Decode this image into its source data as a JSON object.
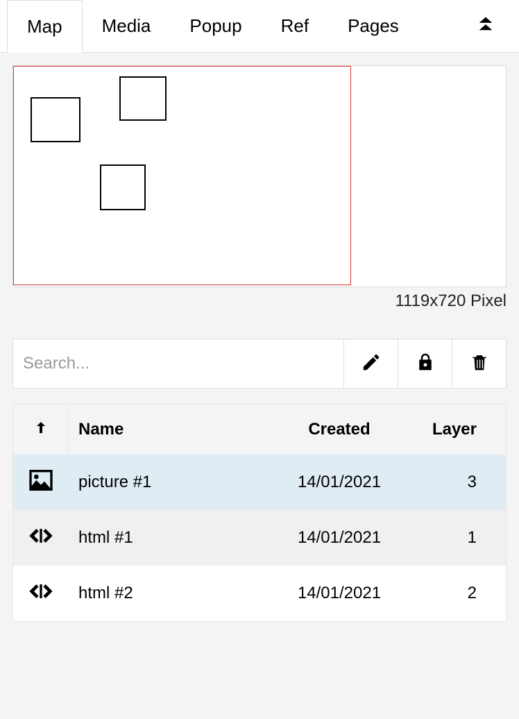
{
  "tabs": {
    "map": "Map",
    "media": "Media",
    "popup": "Popup",
    "ref": "Ref",
    "pages": "Pages"
  },
  "active_tab": "map",
  "preview": {
    "dimensions_label": "1119x720 Pixel"
  },
  "toolbar": {
    "search_placeholder": "Search...",
    "search_value": ""
  },
  "table": {
    "header": {
      "name": "Name",
      "created": "Created",
      "layer": "Layer"
    },
    "rows": [
      {
        "icon": "image",
        "name": "picture #1",
        "created": "14/01/2021",
        "layer": "3",
        "selected": true
      },
      {
        "icon": "code",
        "name": "html #1",
        "created": "14/01/2021",
        "layer": "1",
        "alt": true
      },
      {
        "icon": "code",
        "name": "html #2",
        "created": "14/01/2021",
        "layer": "2"
      }
    ]
  }
}
